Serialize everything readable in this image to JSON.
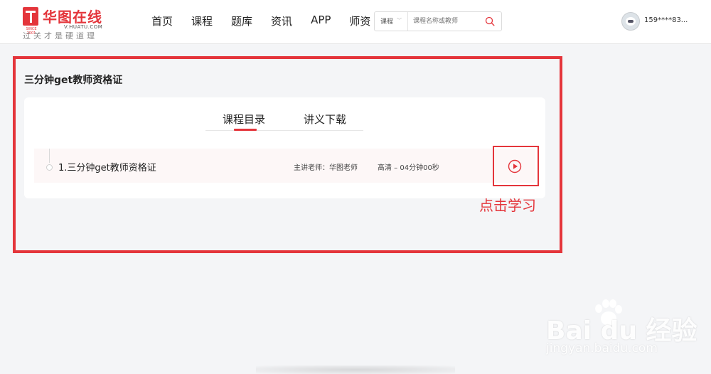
{
  "header": {
    "logo": {
      "brand_name": "华图在线",
      "url_text": "V.HUATU.COM",
      "since_text": "SINCE 2001",
      "slogan": "过关才是硬道理"
    },
    "nav": [
      {
        "label": "首页"
      },
      {
        "label": "课程"
      },
      {
        "label": "题库"
      },
      {
        "label": "资讯"
      },
      {
        "label": "APP"
      },
      {
        "label": "师资"
      }
    ],
    "search": {
      "category": "课程",
      "placeholder": "课程名称或教师",
      "icon": "search-icon"
    },
    "user": {
      "username": "159****83..."
    }
  },
  "course": {
    "title": "三分钟get教师资格证",
    "tabs": [
      {
        "label": "课程目录",
        "active": true
      },
      {
        "label": "讲义下载",
        "active": false
      }
    ],
    "lessons": [
      {
        "title": "1.三分钟get教师资格证",
        "teacher": "主讲老师：华图老师",
        "meta": "高清 – 04分钟00秒",
        "action_icon": "play-icon"
      }
    ]
  },
  "annotation": {
    "label": "点击学习"
  },
  "watermark": {
    "logo_text": "Bai  du 经验",
    "sub_text": "jingyan.baidu.com"
  },
  "colors": {
    "brand_red": "#e4353b",
    "page_bg": "#f4f5f7",
    "row_bg": "#fdf7f7"
  }
}
